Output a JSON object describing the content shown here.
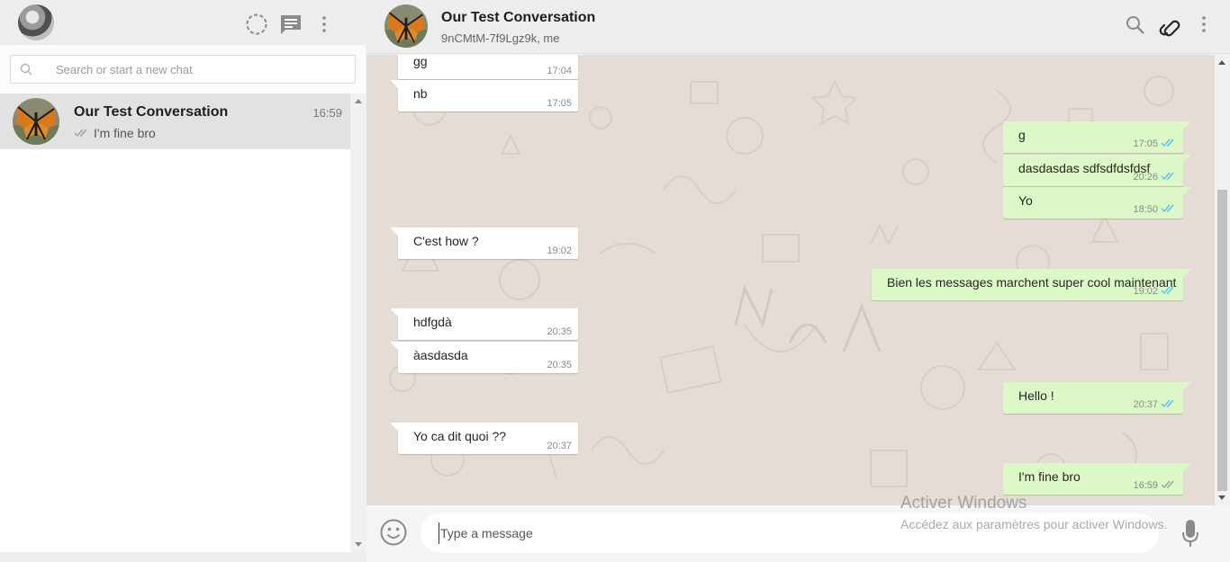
{
  "left_header": {
    "icons": [
      "status-icon",
      "new-chat-icon",
      "menu-icon"
    ]
  },
  "search": {
    "placeholder": "Search or start a new chat"
  },
  "chat_list": [
    {
      "name": "Our Test Conversation",
      "time": "16:59",
      "preview": "I'm fine bro",
      "preview_status": "double-check-icon"
    }
  ],
  "conversation": {
    "title": "Our Test Conversation",
    "subtitle": "9nCMtM-7f9Lgz9k, me",
    "icons": [
      "search-icon",
      "attach-icon",
      "menu-icon"
    ]
  },
  "messages": [
    {
      "dir": "in",
      "text": "gg",
      "time": "17:04"
    },
    {
      "dir": "in",
      "text": "nb",
      "time": "17:05"
    },
    {
      "dir": "out",
      "text": "g",
      "time": "17:05",
      "status": "read"
    },
    {
      "dir": "out",
      "text": "dasdasdas sdfsdfdsfdsf",
      "time": "20:26",
      "status": "read"
    },
    {
      "dir": "out",
      "text": "Yo",
      "time": "18:50",
      "status": "read"
    },
    {
      "dir": "in",
      "text": "C'est how ?",
      "time": "19:02"
    },
    {
      "dir": "out",
      "text": "Bien les messages marchent super cool maintenant",
      "time": "19:02",
      "status": "read"
    },
    {
      "dir": "in",
      "text": "hdfgdà",
      "time": "20:35"
    },
    {
      "dir": "in",
      "text": "àasdasda",
      "time": "20:35"
    },
    {
      "dir": "out",
      "text": "Hello !",
      "time": "20:37",
      "status": "read"
    },
    {
      "dir": "in",
      "text": "Yo ca dit quoi ??",
      "time": "20:37"
    },
    {
      "dir": "out",
      "text": "I'm fine bro",
      "time": "16:59",
      "status": "delivered"
    }
  ],
  "composer": {
    "placeholder": "Type a message"
  },
  "watermark": {
    "title": "Activer Windows",
    "subtitle": "Accédez aux paramètres pour activer Windows."
  },
  "colors": {
    "outgoing_bubble": "#dcf8c6",
    "incoming_bubble": "#ffffff",
    "chat_background": "#e5ddd5",
    "read_check": "#4fc3f7",
    "delivered_check": "#9e9e9e"
  }
}
